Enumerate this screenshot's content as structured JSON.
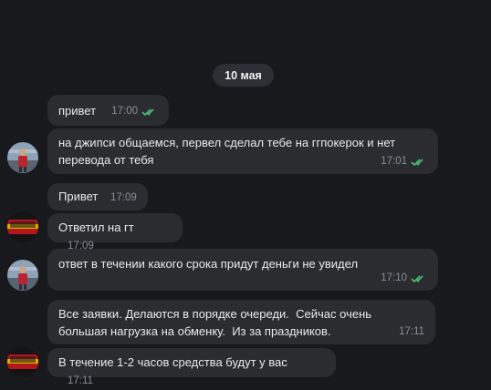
{
  "date_separator": "10 мая",
  "messages": [
    {
      "text": "привет",
      "time": "17:00",
      "read": true
    },
    {
      "text": "на джипси общаемся, первел сделал тебе на ггпокерок и нет\nперевода от тебя",
      "time": "17:01",
      "read": true
    },
    {
      "text": "Привет",
      "time": "17:09"
    },
    {
      "text": "Ответил на гт",
      "time": "17:09"
    },
    {
      "text": "ответ в течении какого срока придут деньги не увидел",
      "time": "17:10",
      "read": true
    },
    {
      "text": "Все заявки. Делаются в порядке очереди.  Сейчас очень\nбольшая нагрузка на обменку.  Из за праздников.",
      "time": "17:11"
    },
    {
      "text": "В течение 1-2 часов средства будут у вас",
      "time": "17:11"
    }
  ],
  "avatars": {
    "user_photo_icon": "person-photo-icon",
    "partner_logo_text": "leva"
  },
  "colors": {
    "background": "#17191c",
    "bubble": "#2a2c30",
    "read_check": "#4fbb7a",
    "time": "#8a8f96"
  }
}
